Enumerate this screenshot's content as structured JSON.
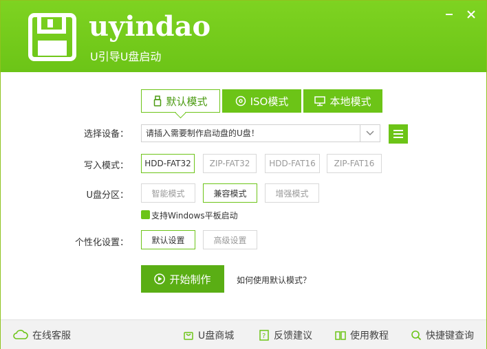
{
  "header": {
    "brand": "uyindao",
    "tagline": "U引导U盘启动",
    "minimize_icon": "minimize-icon",
    "close_icon": "close-icon"
  },
  "tabs": [
    {
      "label": "默认模式",
      "icon": "usb-icon",
      "active": true
    },
    {
      "label": "ISO模式",
      "icon": "disc-icon",
      "active": false
    },
    {
      "label": "本地模式",
      "icon": "monitor-icon",
      "active": false
    }
  ],
  "device": {
    "label": "选择设备",
    "colon": "：",
    "value": "请插入需要制作启动盘的U盘！"
  },
  "write_mode": {
    "label": "写入模式",
    "colon": "：",
    "options": [
      "HDD-FAT32",
      "ZIP-FAT32",
      "HDD-FAT16",
      "ZIP-FAT16"
    ],
    "selected": "HDD-FAT32"
  },
  "partition": {
    "label": "U盘分区",
    "colon": "：",
    "options": [
      "智能模式",
      "兼容模式",
      "增强模式"
    ],
    "selected": "兼容模式"
  },
  "windows_tablet": {
    "label": "支持Windows平板启动",
    "checked": true
  },
  "personalize": {
    "label": "个性化设置",
    "colon": "：",
    "options": [
      "默认设置",
      "高级设置"
    ],
    "selected": "默认设置"
  },
  "actions": {
    "start_label": "开始制作",
    "help_link": "如何使用默认模式？"
  },
  "footer": {
    "online_service": "在线客服",
    "shop": "U盘商城",
    "feedback": "反馈建议",
    "tutorial": "使用教程",
    "shortcut_query": "快捷键查询"
  },
  "colors": {
    "brand_green": "#6cc417",
    "header_green": "#7ed321"
  }
}
